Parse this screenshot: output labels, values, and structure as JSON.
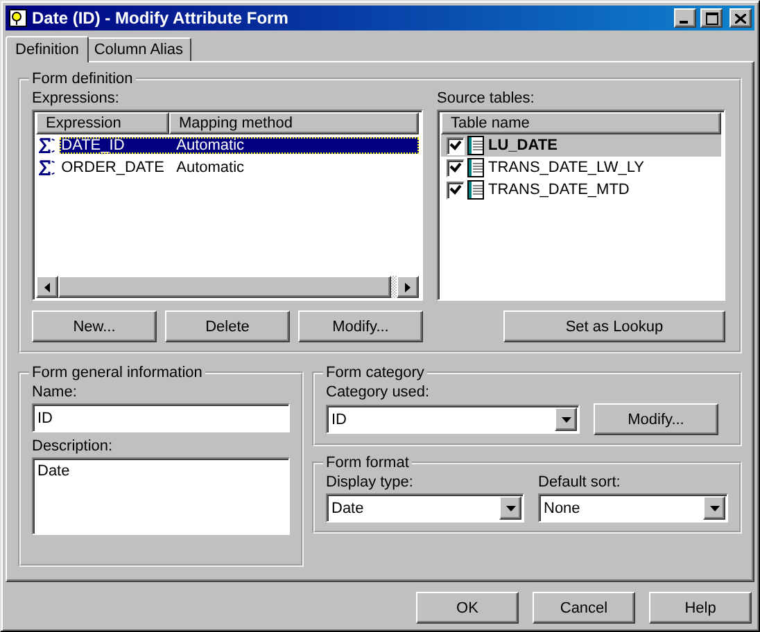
{
  "window": {
    "title": "Date (ID) - Modify Attribute Form"
  },
  "tabs": [
    {
      "label": "Definition",
      "selected": true
    },
    {
      "label": "Column Alias",
      "selected": false
    }
  ],
  "form_definition": {
    "title": "Form definition",
    "expressions": {
      "label": "Expressions:",
      "columns": [
        "Expression",
        "Mapping method"
      ],
      "rows": [
        {
          "expression": "DATE_ID",
          "mapping": "Automatic",
          "selected": true
        },
        {
          "expression": "ORDER_DATE",
          "mapping": "Automatic",
          "selected": false
        }
      ]
    },
    "buttons": [
      "New...",
      "Delete",
      "Modify..."
    ],
    "source_tables": {
      "label": "Source tables:",
      "columns": [
        "Table name"
      ],
      "rows": [
        {
          "name": "LU_DATE",
          "checked": true,
          "selected": true,
          "lookup": true
        },
        {
          "name": "TRANS_DATE_LW_LY",
          "checked": true,
          "selected": false,
          "lookup": false
        },
        {
          "name": "TRANS_DATE_MTD",
          "checked": true,
          "selected": false,
          "lookup": false
        }
      ]
    },
    "lookup_button": "Set as Lookup"
  },
  "general": {
    "title": "Form general information",
    "name_label": "Name:",
    "name_value": "ID",
    "description_label": "Description:",
    "description_value": "Date"
  },
  "category": {
    "title": "Form category",
    "label": "Category used:",
    "value": "ID",
    "button": "Modify..."
  },
  "format": {
    "title": "Form format",
    "display_label": "Display type:",
    "display_value": "Date",
    "sort_label": "Default sort:",
    "sort_value": "None"
  },
  "buttons": [
    "OK",
    "Cancel",
    "Help"
  ]
}
